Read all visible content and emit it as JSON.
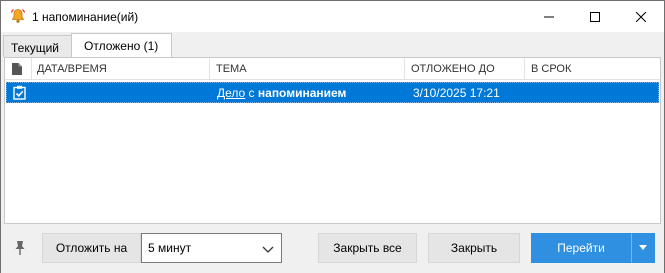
{
  "window": {
    "title": "1 напоминание(ий)",
    "icon": "bell-icon"
  },
  "tabs": [
    {
      "label": "Текущий",
      "active": false
    },
    {
      "label": "Отложено (1)",
      "active": true
    }
  ],
  "columns": {
    "type_icon": "document-icon",
    "datetime": "ДАТА/ВРЕМЯ",
    "subject": "ТЕМА",
    "snoozed_until": "ОТЛОЖЕНО ДО",
    "due": "В СРОК"
  },
  "reminders": [
    {
      "icon": "task-icon",
      "subject_link": "Дело",
      "subject_middle": " с ",
      "subject_bold": "напоминанием",
      "snoozed_until": "3/10/2025 17:21",
      "due": "",
      "datetime": "",
      "selected": true
    }
  ],
  "footer": {
    "pin_icon": "pin-icon",
    "snooze_label": "Отложить на",
    "snooze_value": "5 минут",
    "close_all_label": "Закрыть все",
    "close_label": "Закрыть",
    "go_label": "Перейти"
  },
  "colors": {
    "selection": "#0078d7",
    "accent_button": "#2f8fe0"
  }
}
